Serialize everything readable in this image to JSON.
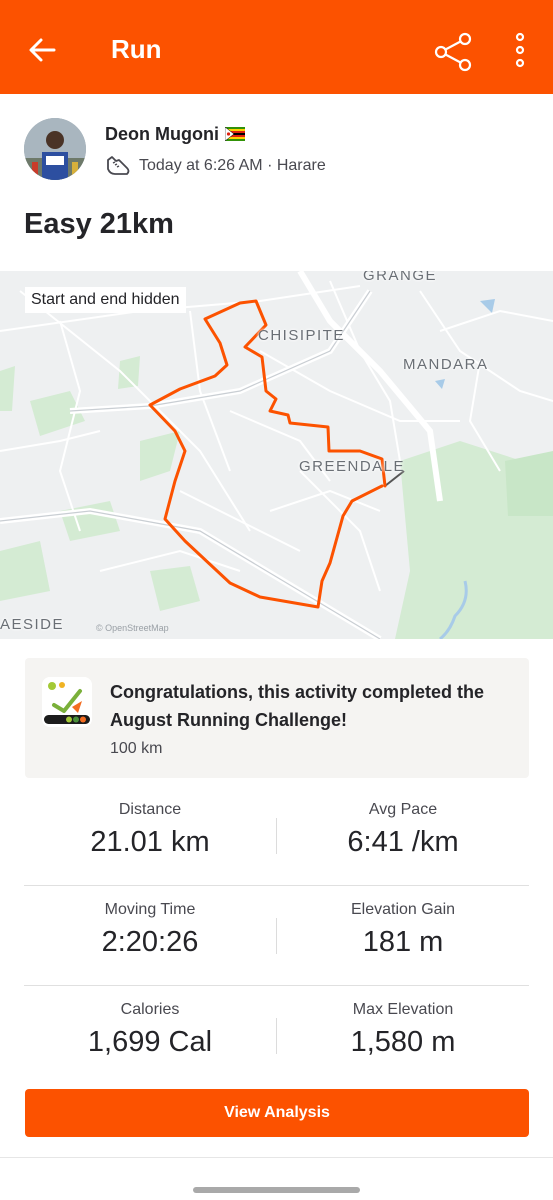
{
  "appbar": {
    "title": "Run",
    "icons": {
      "back": "arrow-left-icon",
      "share": "share-icon",
      "more": "more-vertical-icon"
    }
  },
  "athlete": {
    "name": "Deon Mugoni",
    "flag": "zimbabwe-flag-icon",
    "sport_icon": "running-shoe-icon",
    "time_location": "Today at 6:26 AM · Harare"
  },
  "activity": {
    "title": "Easy 21km"
  },
  "map": {
    "privacy_label": "Start and end hidden",
    "places": {
      "grange": "GRANGE",
      "chisipite": "CHISIPITE",
      "mandara": "MANDARA",
      "greendale": "GREENDALE",
      "braeside": "AESIDE"
    },
    "credit": "© OpenStreetMap",
    "route_color": "#fc5200"
  },
  "challenge": {
    "badge_icon": "august-running-challenge-badge",
    "text": "Congratulations, this activity completed the August Running Challenge!",
    "goal": "100 km"
  },
  "stats": {
    "distance": {
      "label": "Distance",
      "value": "21.01 km"
    },
    "avg_pace": {
      "label": "Avg Pace",
      "value": "6:41 /km"
    },
    "moving_time": {
      "label": "Moving Time",
      "value": "2:20:26"
    },
    "elevation_gain": {
      "label": "Elevation Gain",
      "value": "181 m"
    },
    "calories": {
      "label": "Calories",
      "value": "1,699 Cal"
    },
    "max_elevation": {
      "label": "Max Elevation",
      "value": "1,580 m"
    }
  },
  "actions": {
    "view_analysis": "View Analysis"
  },
  "colors": {
    "brand": "#fc5200",
    "card_bg": "#f5f4f2",
    "text": "#242428"
  }
}
